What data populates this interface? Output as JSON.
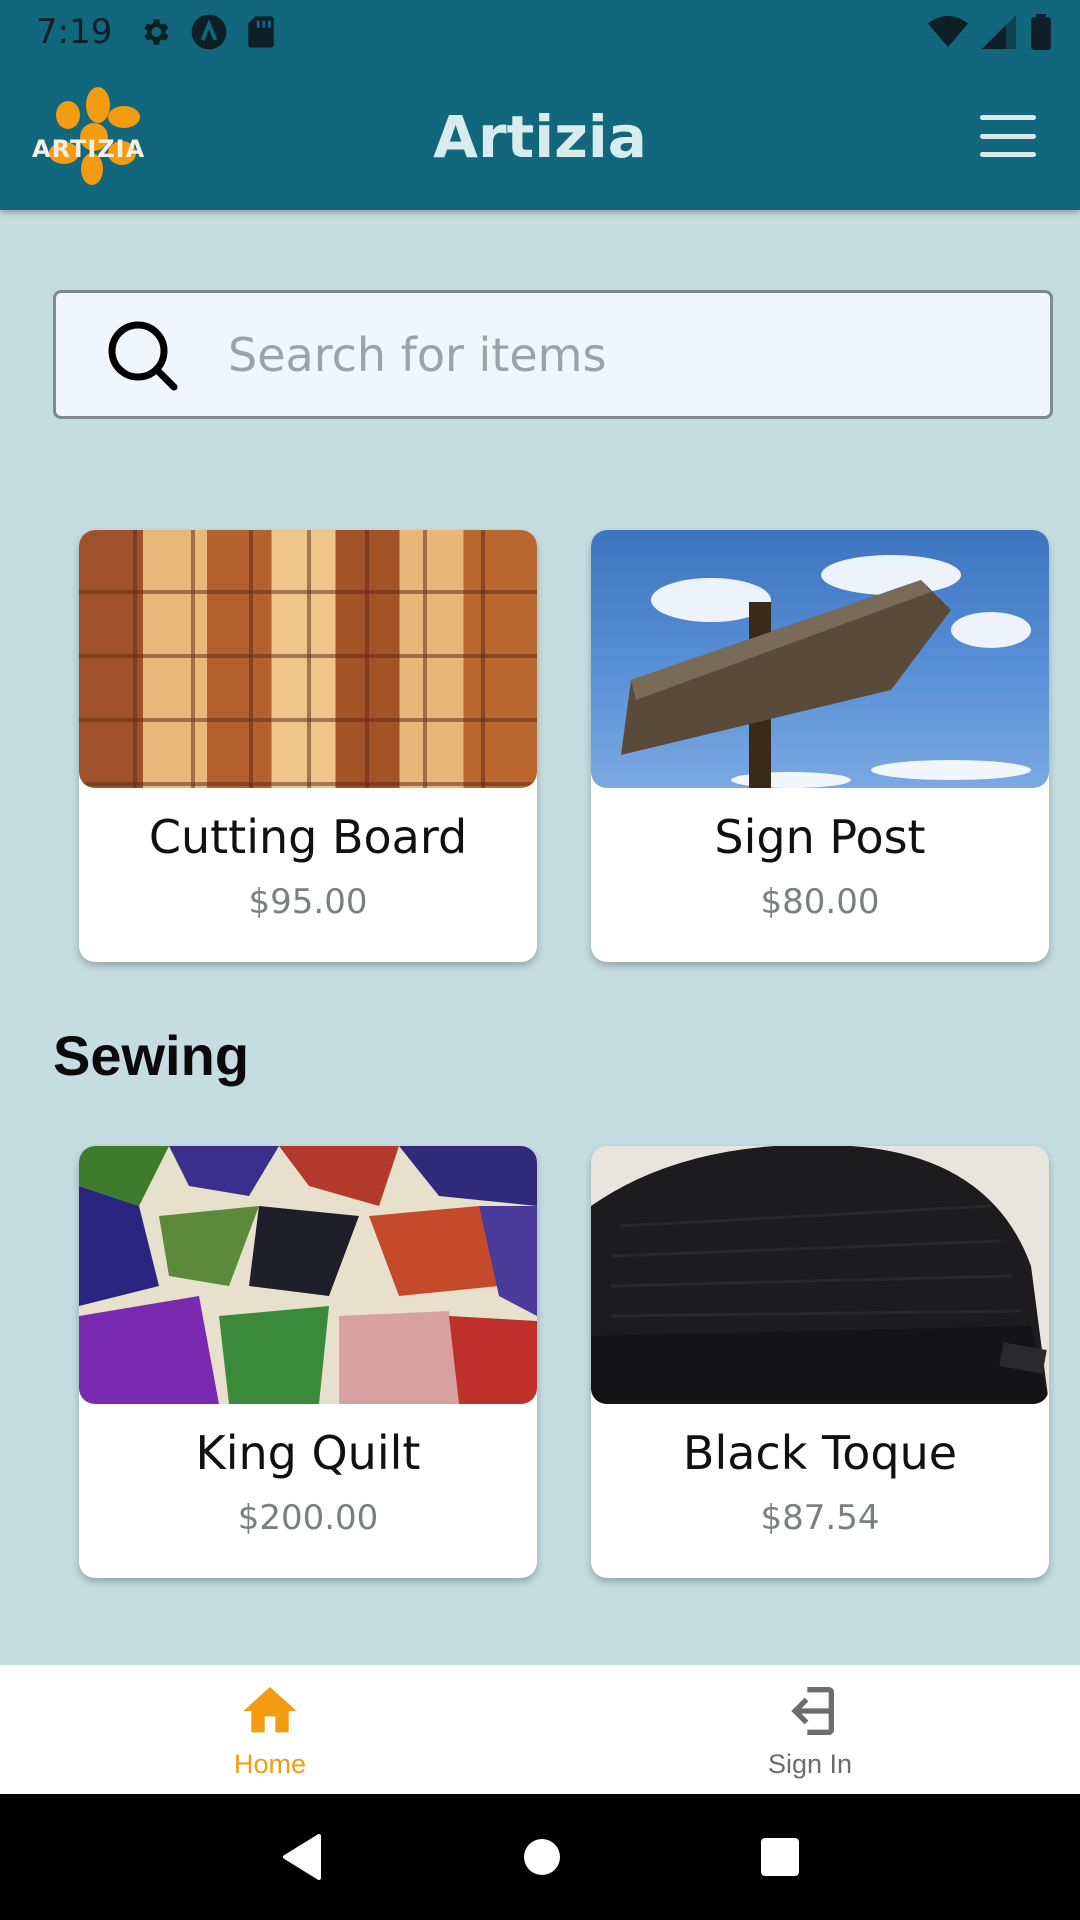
{
  "status_bar": {
    "time": "7:19",
    "icons": [
      "gear-icon",
      "a-badge-icon",
      "sd-card-icon",
      "wifi-icon",
      "signal-icon",
      "battery-icon"
    ]
  },
  "app_bar": {
    "logo_text": "ARTIZIA",
    "title": "Artizia",
    "menu_icon": "hamburger-menu-icon"
  },
  "search": {
    "placeholder": "Search for items",
    "value": ""
  },
  "sections": [
    {
      "title": "",
      "items": [
        {
          "name": "Cutting Board",
          "price": "$95.00",
          "image": "cutting-board-image"
        },
        {
          "name": "Sign Post",
          "price": "$80.00",
          "image": "sign-post-image"
        }
      ]
    },
    {
      "title": "Sewing",
      "items": [
        {
          "name": "King Quilt",
          "price": "$200.00",
          "image": "king-quilt-image"
        },
        {
          "name": "Black Toque",
          "price": "$87.54",
          "image": "black-toque-image"
        }
      ]
    }
  ],
  "bottom_nav": {
    "items": [
      {
        "label": "Home",
        "icon": "home-icon",
        "active": true
      },
      {
        "label": "Sign In",
        "icon": "sign-in-icon",
        "active": false
      }
    ]
  },
  "colors": {
    "primary": "#13677d",
    "background": "#c5dde1",
    "accent": "#f39c12"
  }
}
